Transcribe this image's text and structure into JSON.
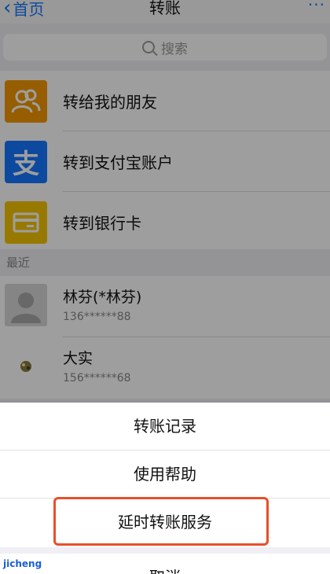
{
  "nav": {
    "back_label": "首页",
    "title": "转账",
    "more": "···"
  },
  "search": {
    "placeholder": "搜索"
  },
  "menu": [
    {
      "label": "转给我的朋友",
      "icon": "friends-icon"
    },
    {
      "label": "转到支付宝账户",
      "icon": "alipay-icon",
      "glyph": "支"
    },
    {
      "label": "转到银行卡",
      "icon": "bank-card-icon"
    }
  ],
  "recent": {
    "title": "最近",
    "contacts": [
      {
        "name": "林芬(*林芬)",
        "phone": "136******88"
      },
      {
        "name": "大实",
        "phone": "156******68"
      }
    ]
  },
  "sheet": {
    "items": [
      "转账记录",
      "使用帮助",
      "延时转账服务"
    ],
    "cancel": "取消",
    "highlight_color": "#e8502a"
  },
  "watermark": "jicheng",
  "colors": {
    "accent": "#1677ff",
    "friend_icon": "#f39800",
    "bank_icon": "#f5c400"
  }
}
